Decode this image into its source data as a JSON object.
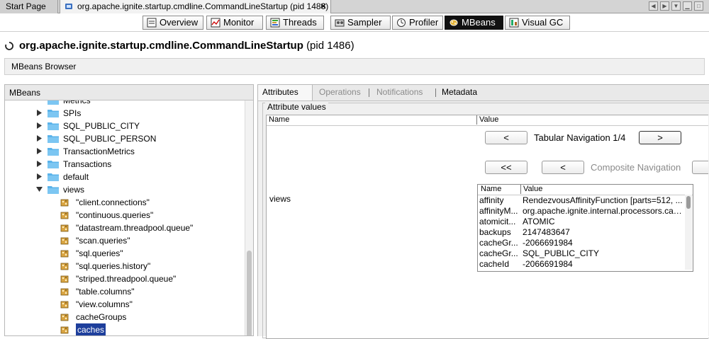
{
  "doc_tabs": {
    "start_page": "Start Page",
    "app_tab": "org.apache.ignite.startup.cmdline.CommandLineStartup (pid 1486)",
    "close": "✕"
  },
  "view_buttons": [
    {
      "label": "Overview",
      "icon": "overview-icon"
    },
    {
      "label": "Monitor",
      "icon": "monitor-icon"
    },
    {
      "label": "Threads",
      "icon": "threads-icon"
    },
    {
      "label": "Sampler",
      "icon": "sampler-icon"
    },
    {
      "label": "Profiler",
      "icon": "profiler-icon"
    },
    {
      "label": "MBeans",
      "icon": "mbeans-icon",
      "active": true
    },
    {
      "label": "Visual GC",
      "icon": "visual-gc-icon"
    }
  ],
  "title": {
    "main": "org.apache.ignite.startup.cmdline.CommandLineStartup",
    "pid": "(pid 1486)"
  },
  "browser_label": "MBeans Browser",
  "left_panel": {
    "header": "MBeans",
    "tree": [
      {
        "label": "Metrics",
        "type": "folder",
        "partial": true
      },
      {
        "label": "SPIs",
        "type": "folder",
        "state": "collapsed"
      },
      {
        "label": "SQL_PUBLIC_CITY",
        "type": "folder",
        "state": "collapsed"
      },
      {
        "label": "SQL_PUBLIC_PERSON",
        "type": "folder",
        "state": "collapsed"
      },
      {
        "label": "TransactionMetrics",
        "type": "folder",
        "state": "collapsed"
      },
      {
        "label": "Transactions",
        "type": "folder",
        "state": "collapsed"
      },
      {
        "label": "default",
        "type": "folder",
        "state": "collapsed"
      },
      {
        "label": "views",
        "type": "folder",
        "state": "expanded"
      },
      {
        "label": "\"client.connections\"",
        "type": "bean"
      },
      {
        "label": "\"continuous.queries\"",
        "type": "bean"
      },
      {
        "label": "\"datastream.threadpool.queue\"",
        "type": "bean"
      },
      {
        "label": "\"scan.queries\"",
        "type": "bean"
      },
      {
        "label": "\"sql.queries\"",
        "type": "bean"
      },
      {
        "label": "\"sql.queries.history\"",
        "type": "bean"
      },
      {
        "label": "\"striped.threadpool.queue\"",
        "type": "bean"
      },
      {
        "label": "\"table.columns\"",
        "type": "bean"
      },
      {
        "label": "\"view.columns\"",
        "type": "bean"
      },
      {
        "label": "cacheGroups",
        "type": "bean"
      },
      {
        "label": "caches",
        "type": "bean",
        "selected": true
      }
    ]
  },
  "right_tabs": [
    {
      "label": "Attributes",
      "active": true
    },
    {
      "label": "Operations",
      "disabled": true
    },
    {
      "label": "Notifications",
      "disabled": true
    },
    {
      "label": "Metadata"
    }
  ],
  "attributes": {
    "legend": "Attribute values",
    "col_name": "Name",
    "col_value": "Value",
    "row_name": "views",
    "tabular_prev": "<",
    "tabular_label": "Tabular Navigation 1/4",
    "tabular_next": ">",
    "composite_first": "<<",
    "composite_prev": "<",
    "composite_label": "Composite Navigation",
    "inner_col_name": "Name",
    "inner_col_value": "Value",
    "inner_rows": [
      {
        "name": "affinity",
        "value": "RendezvousAffinityFunction [parts=512, ..."
      },
      {
        "name": "affinityM...",
        "value": "org.apache.ignite.internal.processors.cac..."
      },
      {
        "name": "atomicit...",
        "value": "ATOMIC"
      },
      {
        "name": "backups",
        "value": "2147483647"
      },
      {
        "name": "cacheGr...",
        "value": "-2066691984"
      },
      {
        "name": "cacheGr...",
        "value": "SQL_PUBLIC_CITY"
      },
      {
        "name": "cacheId",
        "value": "-2066691984"
      }
    ]
  },
  "colors": {
    "selection": "#1e3f9c",
    "active_tab": "#111111",
    "folder": "#5ab3ea",
    "scroll_accent": "#4a86d8"
  }
}
